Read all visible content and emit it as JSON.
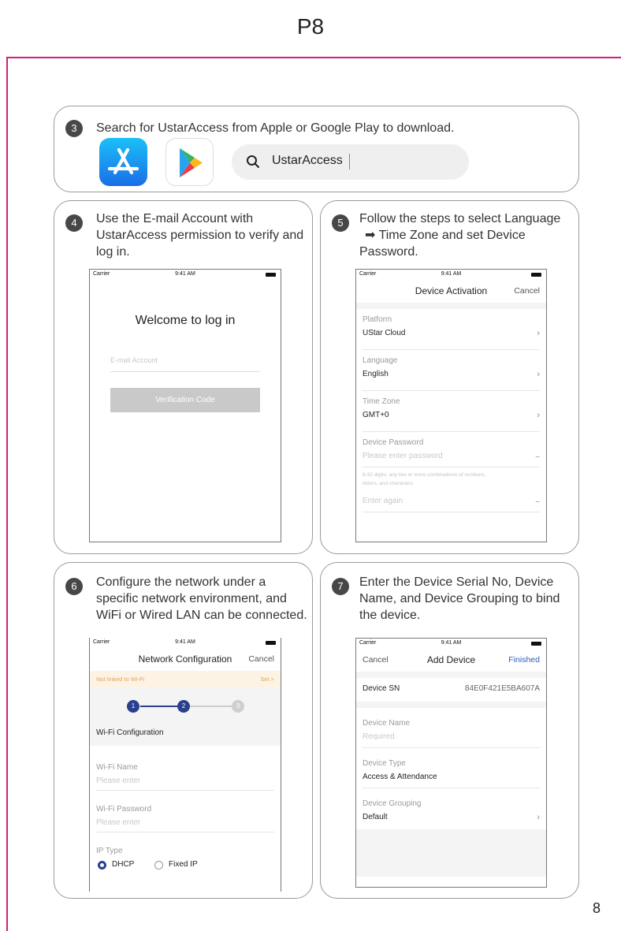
{
  "page": {
    "header": "P8",
    "number": "8"
  },
  "step3": {
    "badge": "3",
    "text": "Search for UstarAccess from Apple or Google Play to download.",
    "search_value": "UstarAccess"
  },
  "step4": {
    "badge": "4",
    "text": "Use the E-mail Account with UstarAccess permission to verify and log in.",
    "phone": {
      "carrier": "Carrier",
      "time": "9:41 AM",
      "welcome": "Welcome to log in",
      "email_placeholder": "E-mail Account",
      "button": "Verification Code"
    }
  },
  "step5": {
    "badge": "5",
    "text_line1": "Follow the steps to select Language",
    "text_line2": "Time Zone  and set Device",
    "text_line3": "Password.",
    "phone": {
      "carrier": "Carrier",
      "time": "9:41 AM",
      "title": "Device Activation",
      "cancel": "Cancel",
      "platform_label": "Platform",
      "platform_value": "UStar Cloud",
      "language_label": "Language",
      "language_value": "English",
      "timezone_label": "Time Zone",
      "timezone_value": "GMT+0",
      "password_label": "Device Password",
      "password_placeholder": "Please enter password",
      "hint_line1": "8-32 digits, any two or more combinations of numbers,",
      "hint_line2": "letters, and characters",
      "again_placeholder": "Enter again"
    }
  },
  "step6": {
    "badge": "6",
    "text": "Configure the network under a specific network environment, and WiFi or Wired LAN can be connected.",
    "phone": {
      "carrier": "Carrier",
      "time": "9:41 AM",
      "title": "Network Configuration",
      "cancel": "Cancel",
      "banner_text": "Not linked to Wi-Fi",
      "banner_action": "Set >",
      "steps": [
        "1",
        "2",
        "3"
      ],
      "section_title": "Wi-Fi Configuration",
      "wifi_name_label": "Wi-Fi Name",
      "wifi_name_placeholder": "Please enter",
      "wifi_password_label": "Wi-Fi Password",
      "wifi_password_placeholder": "Please enter",
      "ip_type_label": "IP Type",
      "ip_option_1": "DHCP",
      "ip_option_2": "Fixed IP"
    }
  },
  "step7": {
    "badge": "7",
    "text": "Enter the Device Serial No, Device Name, and Device Grouping to bind the device.",
    "phone": {
      "carrier": "Carrier",
      "time": "9:41 AM",
      "cancel": "Cancel",
      "title": "Add Device",
      "finished": "Finished",
      "sn_label": "Device SN",
      "sn_value": "84E0F421E5BA607A",
      "name_label": "Device Name",
      "name_placeholder": "Required",
      "type_label": "Device Type",
      "type_value": "Access & Attendance",
      "group_label": "Device Grouping",
      "group_value": "Default"
    }
  },
  "colors": {
    "frame": "#d61a7f",
    "badge": "#474747",
    "step_active": "#2a3f8f",
    "finished": "#2a5bb5",
    "banner_bg": "#fdf3e4",
    "banner_text": "#e2a35a"
  },
  "icons": [
    "app-store-icon",
    "google-play-icon",
    "search-icon",
    "wifi-icon",
    "chevron-right-icon",
    "eye-closed-icon"
  ]
}
